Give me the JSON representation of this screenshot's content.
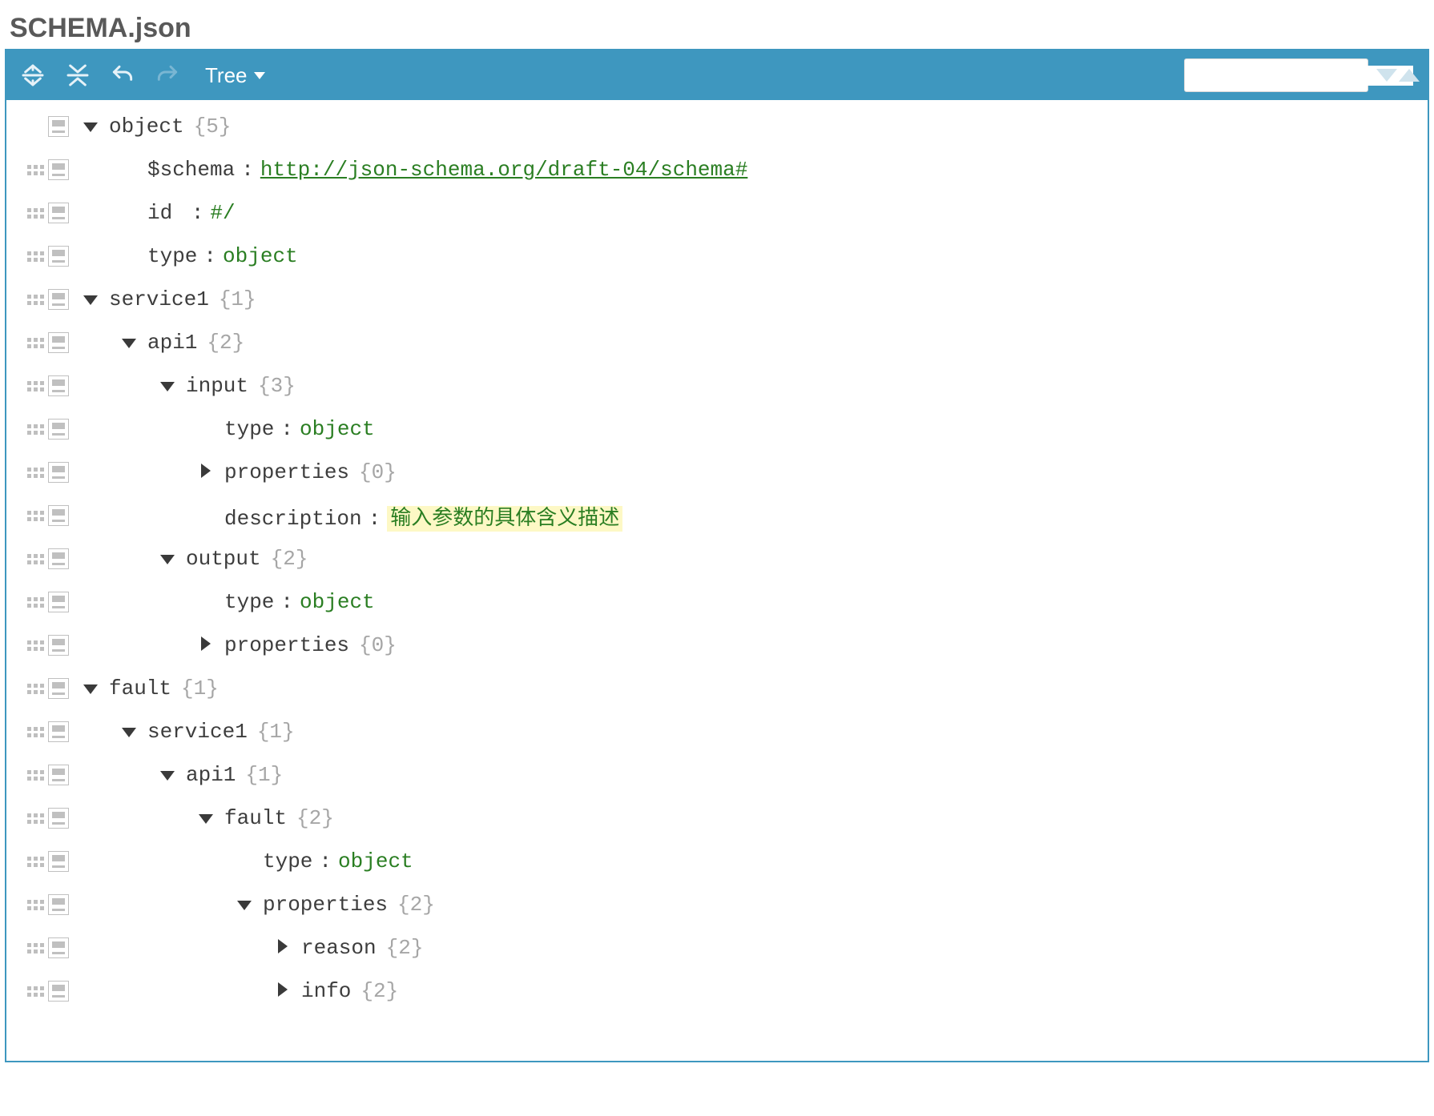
{
  "header": {
    "title": "SCHEMA.json"
  },
  "toolbar": {
    "mode_label": "Tree",
    "buttons": [
      {
        "name": "expand-all",
        "enabled": true
      },
      {
        "name": "collapse-all",
        "enabled": true
      },
      {
        "name": "undo",
        "enabled": true
      },
      {
        "name": "redo",
        "enabled": false
      }
    ],
    "search": {
      "placeholder": ""
    }
  },
  "rows": [
    {
      "grip": false,
      "indent": 0,
      "arrow": "down",
      "key": "object",
      "count": "{5}"
    },
    {
      "grip": true,
      "indent": 1,
      "arrow": "none",
      "key": "$schema",
      "val": "http://json-schema.org/draft-04/schema#",
      "link": true
    },
    {
      "grip": true,
      "indent": 1,
      "arrow": "none",
      "key": "id",
      "key_pad": "id  ",
      "val": "#/"
    },
    {
      "grip": true,
      "indent": 1,
      "arrow": "none",
      "key": "type",
      "val": "object"
    },
    {
      "grip": true,
      "indent": 0,
      "arrow": "down",
      "key": "service1",
      "count": "{1}"
    },
    {
      "grip": true,
      "indent": 1,
      "arrow": "down",
      "key": "api1",
      "count": "{2}"
    },
    {
      "grip": true,
      "indent": 2,
      "arrow": "down",
      "key": "input",
      "count": "{3}"
    },
    {
      "grip": true,
      "indent": 3,
      "arrow": "none",
      "key": "type",
      "val": "object"
    },
    {
      "grip": true,
      "indent": 3,
      "arrow": "right",
      "key": "properties",
      "count": "{0}"
    },
    {
      "grip": true,
      "indent": 3,
      "arrow": "none",
      "key": "description",
      "val": "输入参数的具体含义描述",
      "highlight": true
    },
    {
      "grip": true,
      "indent": 2,
      "arrow": "down",
      "key": "output",
      "count": "{2}"
    },
    {
      "grip": true,
      "indent": 3,
      "arrow": "none",
      "key": "type",
      "val": "object"
    },
    {
      "grip": true,
      "indent": 3,
      "arrow": "right",
      "key": "properties",
      "count": "{0}"
    },
    {
      "grip": true,
      "indent": 0,
      "arrow": "down",
      "key": "fault",
      "count": "{1}"
    },
    {
      "grip": true,
      "indent": 1,
      "arrow": "down",
      "key": "service1",
      "count": "{1}"
    },
    {
      "grip": true,
      "indent": 2,
      "arrow": "down",
      "key": "api1",
      "count": "{1}"
    },
    {
      "grip": true,
      "indent": 3,
      "arrow": "down",
      "key": "fault",
      "count": "{2}"
    },
    {
      "grip": true,
      "indent": 4,
      "arrow": "none",
      "key": "type",
      "val": "object"
    },
    {
      "grip": true,
      "indent": 4,
      "arrow": "down",
      "key": "properties",
      "count": "{2}"
    },
    {
      "grip": true,
      "indent": 5,
      "arrow": "right",
      "key": "reason",
      "count": "{2}"
    },
    {
      "grip": true,
      "indent": 5,
      "arrow": "right",
      "key": "info",
      "count": "{2}"
    }
  ]
}
